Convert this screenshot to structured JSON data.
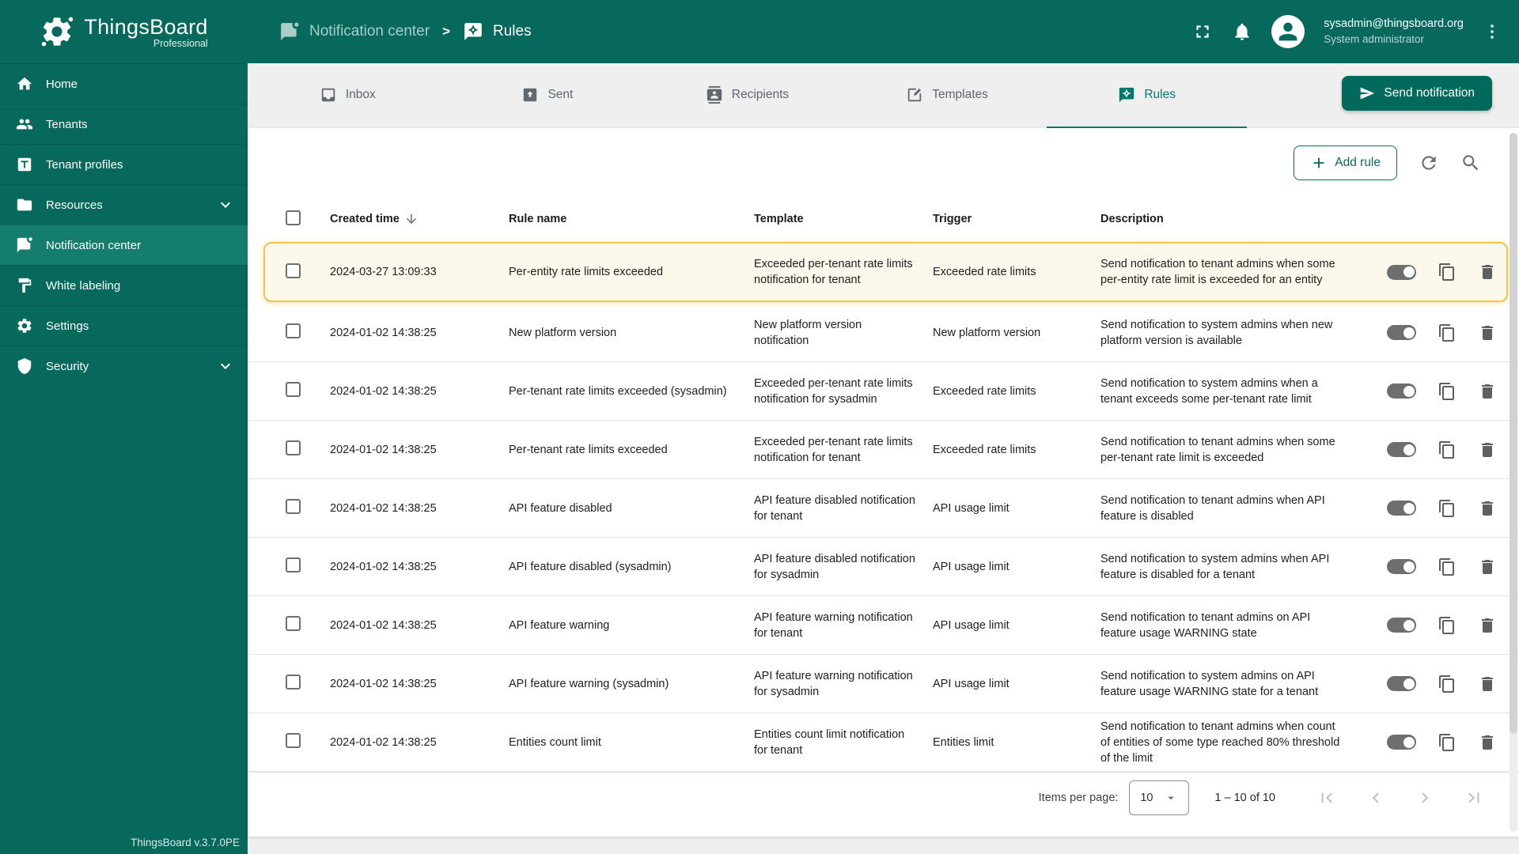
{
  "app": {
    "brand": "ThingsBoard",
    "brand_sub": "Professional",
    "version": "ThingsBoard v.3.7.0PE"
  },
  "colors": {
    "primary": "#07685C",
    "sidebar_active_bg": "#157D6D",
    "accent": "#00796B",
    "highlight_border": "#F3C44D",
    "page_bg": "#EFEFEF"
  },
  "header": {
    "separator": ">",
    "breadcrumb": [
      {
        "label": "Notification center",
        "icon": "notification"
      },
      {
        "label": "Rules",
        "icon": "rules"
      }
    ],
    "user": {
      "email": "sysadmin@thingsboard.org",
      "role": "System administrator"
    }
  },
  "sidebar": {
    "items": [
      {
        "label": "Home",
        "icon": "home",
        "active": false,
        "expandable": false
      },
      {
        "label": "Tenants",
        "icon": "tenants",
        "active": false,
        "expandable": false
      },
      {
        "label": "Tenant profiles",
        "icon": "tenant-profiles",
        "active": false,
        "expandable": false
      },
      {
        "label": "Resources",
        "icon": "folder",
        "active": false,
        "expandable": true
      },
      {
        "label": "Notification center",
        "icon": "notification",
        "active": true,
        "expandable": false
      },
      {
        "label": "White labeling",
        "icon": "white-labeling",
        "active": false,
        "expandable": false
      },
      {
        "label": "Settings",
        "icon": "settings",
        "active": false,
        "expandable": false
      },
      {
        "label": "Security",
        "icon": "security",
        "active": false,
        "expandable": true
      }
    ]
  },
  "tabs": {
    "items": [
      {
        "label": "Inbox",
        "icon": "inbox",
        "active": false
      },
      {
        "label": "Sent",
        "icon": "sent",
        "active": false
      },
      {
        "label": "Recipients",
        "icon": "recipients",
        "active": false
      },
      {
        "label": "Templates",
        "icon": "templates",
        "active": false
      },
      {
        "label": "Rules",
        "icon": "rules",
        "active": true
      }
    ]
  },
  "toolbar": {
    "send_notification_label": "Send notification",
    "add_rule_label": "Add rule"
  },
  "table": {
    "columns": {
      "created": "Created time",
      "name": "Rule name",
      "template": "Template",
      "trigger": "Trigger",
      "description": "Description"
    },
    "sort": {
      "column": "created",
      "direction": "desc"
    },
    "rows": [
      {
        "created": "2024-03-27 13:09:33",
        "name": "Per-entity rate limits exceeded",
        "template": "Exceeded per-tenant rate limits notification for tenant",
        "trigger": "Exceeded rate limits",
        "description": "Send notification to tenant admins when some per-entity rate limit is exceeded for an entity",
        "enabled": true,
        "highlighted": true
      },
      {
        "created": "2024-01-02 14:38:25",
        "name": "New platform version",
        "template": "New platform version notification",
        "trigger": "New platform version",
        "description": "Send notification to system admins when new platform version is available",
        "enabled": true,
        "highlighted": false
      },
      {
        "created": "2024-01-02 14:38:25",
        "name": "Per-tenant rate limits exceeded (sysadmin)",
        "template": "Exceeded per-tenant rate limits notification for sysadmin",
        "trigger": "Exceeded rate limits",
        "description": "Send notification to system admins when a tenant exceeds some per-tenant rate limit",
        "enabled": true,
        "highlighted": false
      },
      {
        "created": "2024-01-02 14:38:25",
        "name": "Per-tenant rate limits exceeded",
        "template": "Exceeded per-tenant rate limits notification for tenant",
        "trigger": "Exceeded rate limits",
        "description": "Send notification to tenant admins when some per-tenant rate limit is exceeded",
        "enabled": true,
        "highlighted": false
      },
      {
        "created": "2024-01-02 14:38:25",
        "name": "API feature disabled",
        "template": "API feature disabled notification for tenant",
        "trigger": "API usage limit",
        "description": "Send notification to tenant admins when API feature is disabled",
        "enabled": true,
        "highlighted": false
      },
      {
        "created": "2024-01-02 14:38:25",
        "name": "API feature disabled (sysadmin)",
        "template": "API feature disabled notification for sysadmin",
        "trigger": "API usage limit",
        "description": "Send notification to system admins when API feature is disabled for a tenant",
        "enabled": true,
        "highlighted": false
      },
      {
        "created": "2024-01-02 14:38:25",
        "name": "API feature warning",
        "template": "API feature warning notification for tenant",
        "trigger": "API usage limit",
        "description": "Send notification to tenant admins on API feature usage WARNING state",
        "enabled": true,
        "highlighted": false
      },
      {
        "created": "2024-01-02 14:38:25",
        "name": "API feature warning (sysadmin)",
        "template": "API feature warning notification for sysadmin",
        "trigger": "API usage limit",
        "description": "Send notification to system admins on API feature usage WARNING state for a tenant",
        "enabled": true,
        "highlighted": false
      },
      {
        "created": "2024-01-02 14:38:25",
        "name": "Entities count limit",
        "template": "Entities count limit notification for tenant",
        "trigger": "Entities limit",
        "description": "Send notification to tenant admins when count of entities of some type reached 80% threshold of the limit",
        "enabled": true,
        "highlighted": false
      }
    ]
  },
  "pagination": {
    "items_per_page_label": "Items per page:",
    "items_per_page_value": "10",
    "range_label": "1 – 10 of 10"
  }
}
